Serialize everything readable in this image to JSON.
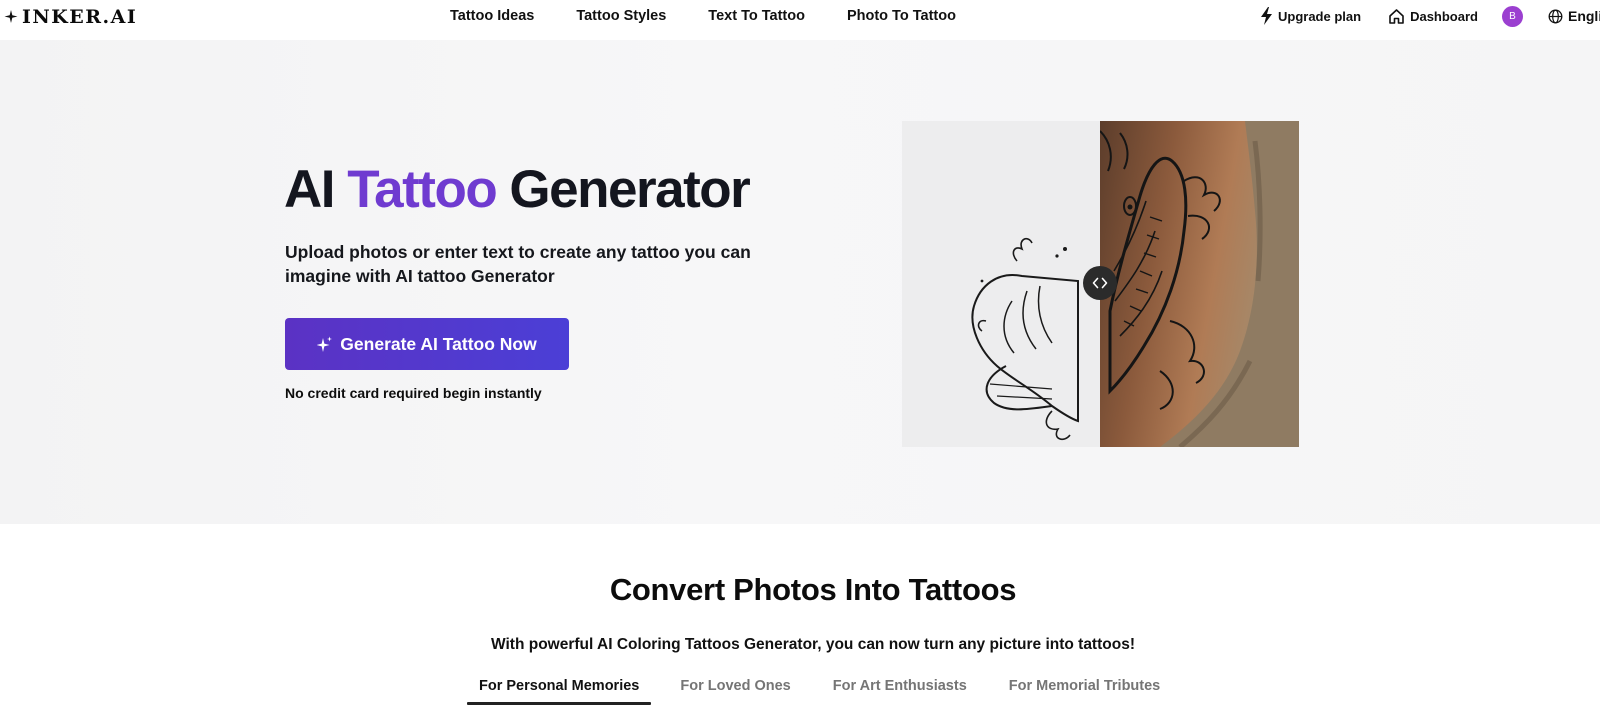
{
  "brand": {
    "logo_text": "INKER.AI"
  },
  "nav": {
    "links": [
      "Tattoo Ideas",
      "Tattoo Styles",
      "Text To Tattoo",
      "Photo To Tattoo"
    ],
    "upgrade_label": "Upgrade plan",
    "dashboard_label": "Dashboard",
    "avatar_initial": "B",
    "language_label": "Englis"
  },
  "hero": {
    "title_part1": "AI ",
    "title_accent": "Tattoo",
    "title_part2": " Generator",
    "subtitle": "Upload photos or enter text to create any tattoo you can imagine with AI tattoo Generator",
    "cta_label": "Generate AI Tattoo Now",
    "cta_note": "No credit card required begin instantly"
  },
  "convert_section": {
    "title": "Convert Photos Into Tattoos",
    "subtitle": "With powerful AI Coloring Tattoos Generator, you can now turn any picture into tattoos!",
    "tabs": [
      "For Personal Memories",
      "For Loved Ones",
      "For Art Enthusiasts",
      "For Memorial Tributes"
    ],
    "active_tab": "For Personal Memories"
  },
  "colors": {
    "accent_purple": "#6f3bd0",
    "cta_start": "#5b32c4",
    "cta_end": "#4b3fd6",
    "avatar": "#9b3fd0"
  },
  "icons": [
    "sparkle-icon",
    "bolt-icon",
    "home-icon",
    "globe-icon",
    "compare-arrows-icon"
  ]
}
